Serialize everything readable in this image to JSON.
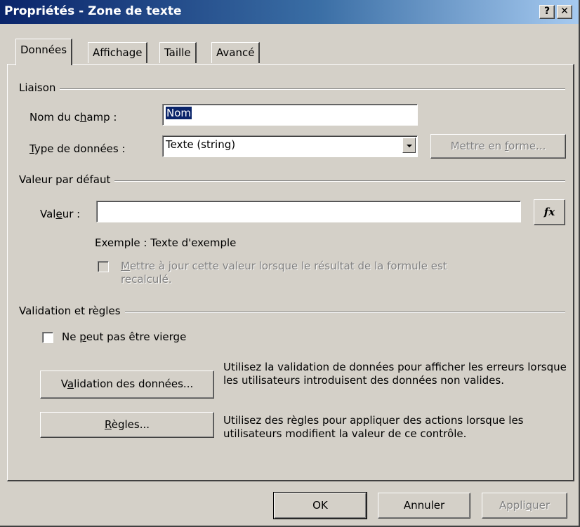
{
  "window": {
    "title": "Propriétés - Zone de texte",
    "help_glyph": "?",
    "close_glyph": "✕"
  },
  "tabs": [
    {
      "label": "Données"
    },
    {
      "label": "Affichage"
    },
    {
      "label": "Taille"
    },
    {
      "label": "Avancé"
    }
  ],
  "liaison": {
    "group_label": "Liaison",
    "field_name_label_pre": "Nom du c",
    "field_name_label_key": "h",
    "field_name_label_post": "amp :",
    "field_name_value": "Nom",
    "data_type_label_key": "T",
    "data_type_label_post": "ype de données :",
    "data_type_value": "Texte (string)",
    "format_button_pre": "Mettre en ",
    "format_button_key": "f",
    "format_button_post": "orme..."
  },
  "default_value": {
    "group_label": "Valeur par défaut",
    "value_label_pre": "Val",
    "value_label_key": "e",
    "value_label_post": "ur :",
    "value": "",
    "fx_label": "fx",
    "example_text": "Exemple : Texte d'exemple",
    "recalc_checkbox_key": "M",
    "recalc_checkbox_line1_post": "ettre à jour cette valeur lorsque le résultat de la formule est",
    "recalc_checkbox_line2": "recalculé."
  },
  "validation": {
    "group_label": "Validation et règles",
    "not_blank_pre": "Ne ",
    "not_blank_key": "p",
    "not_blank_post": "eut pas être vierge",
    "data_validation_button_pre": "V",
    "data_validation_button_key": "a",
    "data_validation_button_post": "lidation des données...",
    "data_validation_desc": "Utilisez la validation de données pour afficher les erreurs lorsque les utilisateurs introduisent des données non valides.",
    "rules_button_key": "R",
    "rules_button_post": "ègles...",
    "rules_desc": "Utilisez des règles pour appliquer des actions lorsque les utilisateurs modifient la valeur de ce contrôle."
  },
  "footer": {
    "ok_label": "OK",
    "cancel_label": "Annuler",
    "apply_pre": "Appli",
    "apply_key": "q",
    "apply_post": "uer"
  },
  "colors": {
    "title_gradient_start": "#0a246a",
    "title_gradient_end": "#a6caf0",
    "face": "#d4d0c8",
    "selection": "#0a246a"
  }
}
